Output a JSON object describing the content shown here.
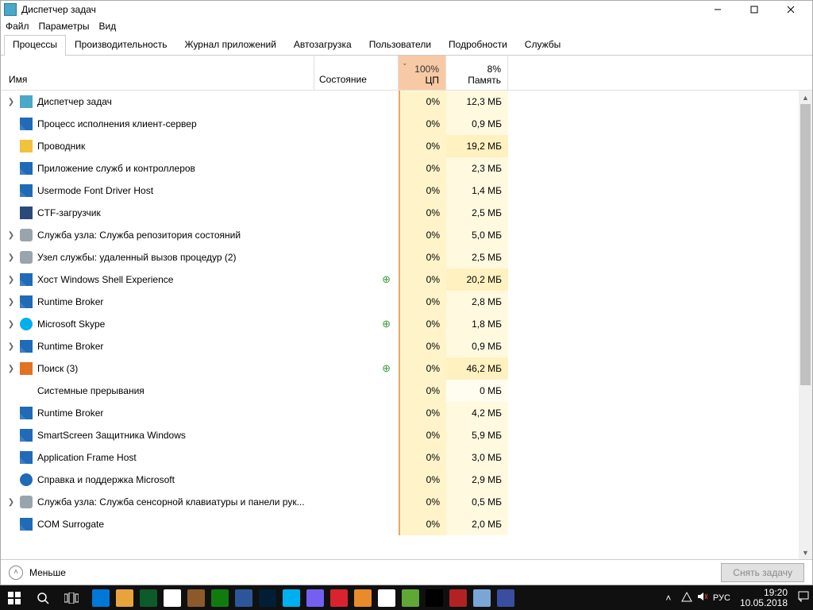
{
  "window": {
    "title": "Диспетчер задач"
  },
  "menu": {
    "file": "Файл",
    "params": "Параметры",
    "view": "Вид"
  },
  "tabs": [
    "Процессы",
    "Производительность",
    "Журнал приложений",
    "Автозагрузка",
    "Пользователи",
    "Подробности",
    "Службы"
  ],
  "active_tab": 0,
  "columns": {
    "name": "Имя",
    "state": "Состояние",
    "cpu": "ЦП",
    "cpu_pct": "100%",
    "mem": "Память",
    "mem_pct": "8%"
  },
  "footer": {
    "less": "Меньше",
    "end_task": "Снять задачу"
  },
  "tray": {
    "lang": "РУС",
    "time": "19:20",
    "date": "10.05.2018"
  },
  "processes": [
    {
      "exp": true,
      "icon": "i-tm",
      "name": "Диспетчер задач",
      "cpu": "0%",
      "mem": "12,3 МБ"
    },
    {
      "exp": false,
      "icon": "i-svc",
      "name": "Процесс исполнения клиент-сервер",
      "cpu": "0%",
      "mem": "0,9 МБ"
    },
    {
      "exp": false,
      "icon": "i-exp",
      "name": "Проводник",
      "cpu": "0%",
      "mem": "19,2 МБ",
      "hi": true
    },
    {
      "exp": false,
      "icon": "i-svc",
      "name": "Приложение служб и контроллеров",
      "cpu": "0%",
      "mem": "2,3 МБ"
    },
    {
      "exp": false,
      "icon": "i-svc",
      "name": "Usermode Font Driver Host",
      "cpu": "0%",
      "mem": "1,4 МБ"
    },
    {
      "exp": false,
      "icon": "i-ctf",
      "name": "CTF-загрузчик",
      "cpu": "0%",
      "mem": "2,5 МБ"
    },
    {
      "exp": true,
      "icon": "i-gear",
      "name": "Служба узла: Служба репозитория состояний",
      "cpu": "0%",
      "mem": "5,0 МБ"
    },
    {
      "exp": true,
      "icon": "i-gear",
      "name": "Узел службы: удаленный вызов процедур (2)",
      "cpu": "0%",
      "mem": "2,5 МБ"
    },
    {
      "exp": true,
      "icon": "i-svc",
      "name": "Хост Windows Shell Experience",
      "leaf": true,
      "cpu": "0%",
      "mem": "20,2 МБ",
      "hi": true
    },
    {
      "exp": true,
      "icon": "i-svc",
      "name": "Runtime Broker",
      "cpu": "0%",
      "mem": "2,8 МБ"
    },
    {
      "exp": true,
      "icon": "i-sky",
      "name": "Microsoft Skype",
      "leaf": true,
      "cpu": "0%",
      "mem": "1,8 МБ"
    },
    {
      "exp": true,
      "icon": "i-svc",
      "name": "Runtime Broker",
      "cpu": "0%",
      "mem": "0,9 МБ"
    },
    {
      "exp": true,
      "icon": "i-srch",
      "name": "Поиск (3)",
      "leaf": true,
      "cpu": "0%",
      "mem": "46,2 МБ",
      "hi": true
    },
    {
      "exp": false,
      "icon": "",
      "name": "Системные прерывания",
      "cpu": "0%",
      "mem": "0 МБ",
      "zero": true
    },
    {
      "exp": false,
      "icon": "i-svc",
      "name": "Runtime Broker",
      "cpu": "0%",
      "mem": "4,2 МБ"
    },
    {
      "exp": false,
      "icon": "i-svc",
      "name": "SmartScreen Защитника Windows",
      "cpu": "0%",
      "mem": "5,9 МБ"
    },
    {
      "exp": false,
      "icon": "i-svc",
      "name": "Application Frame Host",
      "cpu": "0%",
      "mem": "3,0 МБ"
    },
    {
      "exp": false,
      "icon": "i-help",
      "name": "Справка и поддержка Microsoft",
      "cpu": "0%",
      "mem": "2,9 МБ"
    },
    {
      "exp": true,
      "icon": "i-gear",
      "name": "Служба узла: Служба сенсорной клавиатуры и панели рук...",
      "cpu": "0%",
      "mem": "0,5 МБ"
    },
    {
      "exp": false,
      "icon": "i-svc",
      "name": "COM Surrogate",
      "cpu": "0%",
      "mem": "2,0 МБ"
    }
  ],
  "taskbar_icons": [
    "#0078d7",
    "#e8a33d",
    "#0d5a2a",
    "#ffffff",
    "#8c5a2a",
    "#107c10",
    "#2b579a",
    "#001e36",
    "#00aff0",
    "#7360f2",
    "#d9232e",
    "#e88b2a",
    "#ffffff",
    "#5fa836",
    "#000000",
    "#b22222",
    "#7aa6d6",
    "#3a4ea0"
  ]
}
